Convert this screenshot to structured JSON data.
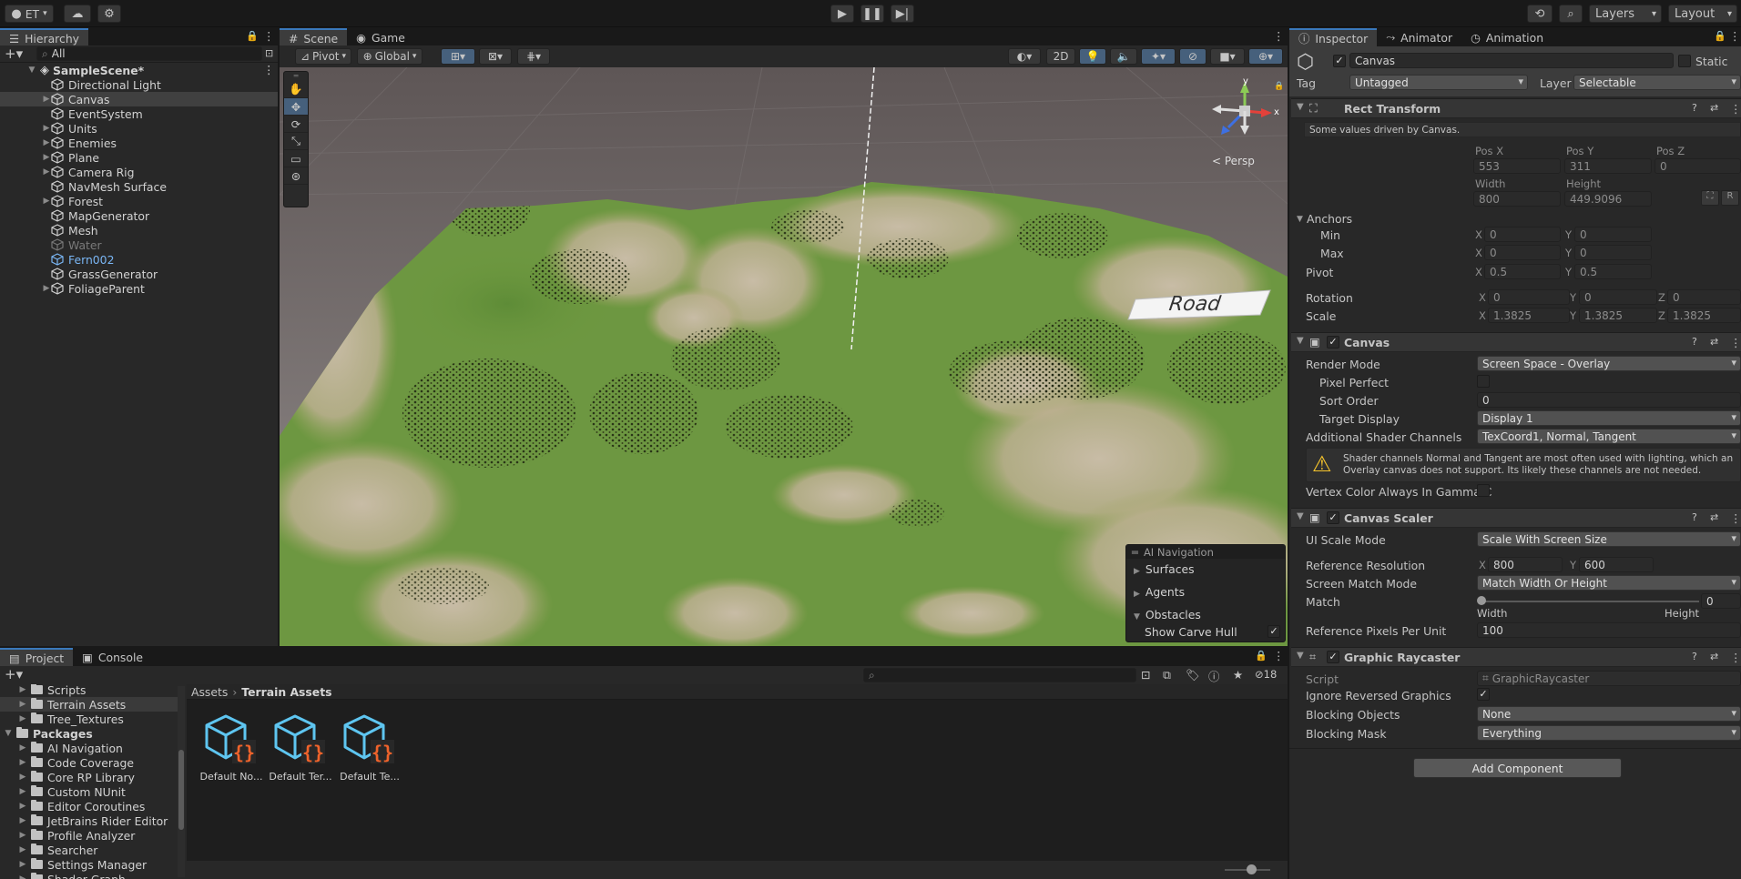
{
  "toolbar": {
    "account": "ET",
    "layers": "Layers",
    "layout": "Layout"
  },
  "hierarchy": {
    "tab": "Hierarchy",
    "search_placeholder": "All",
    "scene": "SampleScene*",
    "items": [
      {
        "label": "Directional Light",
        "expand": false
      },
      {
        "label": "Canvas",
        "expand": true,
        "selected": true
      },
      {
        "label": "EventSystem",
        "expand": false
      },
      {
        "label": "Units",
        "expand": true
      },
      {
        "label": "Enemies",
        "expand": true
      },
      {
        "label": "Plane",
        "expand": true
      },
      {
        "label": "Camera Rig",
        "expand": true
      },
      {
        "label": "NavMesh Surface",
        "expand": false
      },
      {
        "label": "Forest",
        "expand": true
      },
      {
        "label": "MapGenerator",
        "expand": false
      },
      {
        "label": "Mesh",
        "expand": false
      },
      {
        "label": "Water",
        "expand": false,
        "disabled": true
      },
      {
        "label": "Fern002",
        "expand": false,
        "prefab": true
      },
      {
        "label": "GrassGenerator",
        "expand": false
      },
      {
        "label": "FoliageParent",
        "expand": true
      }
    ]
  },
  "scene": {
    "tabs": [
      "Scene",
      "Game"
    ],
    "pivot": "Pivot",
    "global": "Global",
    "mode2d": "2D",
    "persp": "Persp",
    "road": "Road",
    "overlay": {
      "title": "AI Navigation",
      "surfaces": "Surfaces",
      "agents": "Agents",
      "obstacles": "Obstacles",
      "show_carve": "Show Carve Hull",
      "show_carve_on": true
    }
  },
  "project": {
    "tabs": [
      "Project",
      "Console"
    ],
    "badge": "18",
    "tree": [
      {
        "label": "Scripts",
        "level": 1,
        "kind": "folder"
      },
      {
        "label": "Terrain Assets",
        "level": 1,
        "kind": "folder",
        "selected": true
      },
      {
        "label": "Tree_Textures",
        "level": 1,
        "kind": "folder"
      },
      {
        "label": "Packages",
        "level": 0,
        "kind": "folder",
        "bold": true
      },
      {
        "label": "AI Navigation",
        "level": 1,
        "kind": "folder"
      },
      {
        "label": "Code Coverage",
        "level": 1,
        "kind": "folder"
      },
      {
        "label": "Core RP Library",
        "level": 1,
        "kind": "folder"
      },
      {
        "label": "Custom NUnit",
        "level": 1,
        "kind": "folder"
      },
      {
        "label": "Editor Coroutines",
        "level": 1,
        "kind": "folder"
      },
      {
        "label": "JetBrains Rider Editor",
        "level": 1,
        "kind": "folder"
      },
      {
        "label": "Profile Analyzer",
        "level": 1,
        "kind": "folder"
      },
      {
        "label": "Searcher",
        "level": 1,
        "kind": "folder"
      },
      {
        "label": "Settings Manager",
        "level": 1,
        "kind": "folder"
      },
      {
        "label": "Shader Graph",
        "level": 1,
        "kind": "folder"
      }
    ],
    "breadcrumb": [
      "Assets",
      "Terrain Assets"
    ],
    "assets": [
      "Default No...",
      "Default Ter...",
      "Default Te..."
    ]
  },
  "inspector": {
    "tabs": [
      "Inspector",
      "Animator",
      "Animation"
    ],
    "name": "Canvas",
    "static": "Static",
    "tag_label": "Tag",
    "tag": "Untagged",
    "layer_label": "Layer",
    "layer": "Selectable",
    "rect": {
      "title": "Rect Transform",
      "note": "Some values driven by Canvas.",
      "posx_label": "Pos X",
      "posy_label": "Pos Y",
      "posz_label": "Pos Z",
      "posx": "553",
      "posy": "311",
      "posz": "0",
      "width_label": "Width",
      "height_label": "Height",
      "width": "800",
      "height": "449.9096",
      "anchors": "Anchors",
      "min": "Min",
      "max": "Max",
      "min_x": "0",
      "min_y": "0",
      "max_x": "0",
      "max_y": "0",
      "pivot": "Pivot",
      "pivot_x": "0.5",
      "pivot_y": "0.5",
      "rotation": "Rotation",
      "rot_x": "0",
      "rot_y": "0",
      "rot_z": "0",
      "scale": "Scale",
      "scale_x": "1.3825",
      "scale_y": "1.3825",
      "scale_z": "1.3825",
      "r_button": "R"
    },
    "canvas": {
      "title": "Canvas",
      "render_mode_label": "Render Mode",
      "render_mode": "Screen Space - Overlay",
      "pixel_perfect": "Pixel Perfect",
      "sort_order_label": "Sort Order",
      "sort_order": "0",
      "target_display_label": "Target Display",
      "target_display": "Display 1",
      "shader_channels_label": "Additional Shader Channels",
      "shader_channels": "TexCoord1, Normal, Tangent",
      "warning": "Shader channels Normal and Tangent are most often used with lighting, which an Overlay canvas does not support. Its likely these channels are not needed.",
      "vertex_color": "Vertex Color Always In Gamma C"
    },
    "scaler": {
      "title": "Canvas Scaler",
      "ui_scale_label": "UI Scale Mode",
      "ui_scale": "Scale With Screen Size",
      "ref_res_label": "Reference Resolution",
      "ref_x": "800",
      "ref_y": "600",
      "match_mode_label": "Screen Match Mode",
      "match_mode": "Match Width Or Height",
      "match_label": "Match",
      "match_value": "0",
      "width": "Width",
      "height": "Height",
      "ppu_label": "Reference Pixels Per Unit",
      "ppu": "100"
    },
    "raycaster": {
      "title": "Graphic Raycaster",
      "script_label": "Script",
      "script": "GraphicRaycaster",
      "ignore_label": "Ignore Reversed Graphics",
      "blocking_objects_label": "Blocking Objects",
      "blocking_objects": "None",
      "blocking_mask_label": "Blocking Mask",
      "blocking_mask": "Everything"
    },
    "add_component": "Add Component"
  },
  "axis": {
    "x": "x",
    "y": "y",
    "X": "X",
    "Y": "Y",
    "Z": "Z"
  }
}
